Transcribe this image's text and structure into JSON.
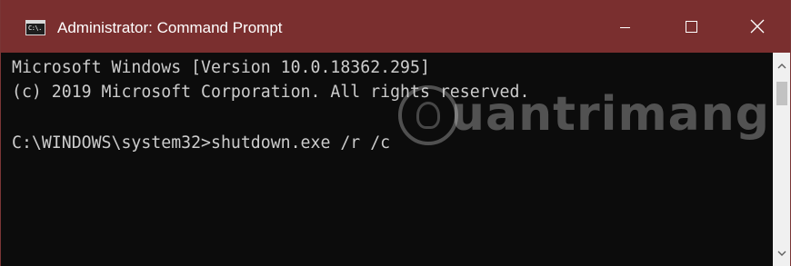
{
  "window": {
    "title": "Administrator: Command Prompt",
    "app_icon": {
      "name": "command-prompt-icon",
      "text": "C:\\."
    },
    "controls": {
      "minimize_icon": "minimize-icon",
      "maximize_icon": "maximize-icon",
      "close_icon": "close-icon"
    },
    "colors": {
      "titlebar": "#7a2f2f",
      "console_background": "#0c0c0c",
      "console_text": "#cccccc"
    }
  },
  "console": {
    "lines": [
      "Microsoft Windows [Version 10.0.18362.295]",
      "(c) 2019 Microsoft Corporation. All rights reserved.",
      "",
      "C:\\WINDOWS\\system32>shutdown.exe /r /c"
    ]
  },
  "scrollbar": {
    "up_icon": "chevron-up-icon",
    "down_icon": "chevron-down-icon"
  },
  "watermark": {
    "text": "uantrimang"
  }
}
